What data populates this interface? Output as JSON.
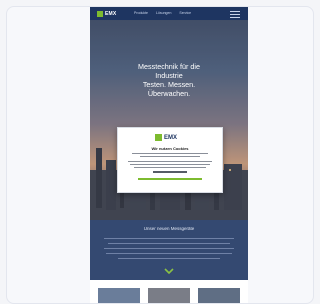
{
  "header": {
    "logo_text": "EMX",
    "nav": [
      "Produkte",
      "Lösungen",
      "Service"
    ]
  },
  "hero": {
    "title": "Messtechnik für die\nIndustrie\nTesten. Messen.\nÜberwachen."
  },
  "modal": {
    "logo_text": "EMX",
    "title": "Wir nutzen Cookies"
  },
  "section": {
    "title": "Unser neuen Messgeräte"
  },
  "colors": {
    "brand_navy": "#1e3561",
    "brand_green": "#7dbb2f"
  },
  "icons": [
    "logo-mark-icon",
    "menu-icon",
    "chevron-down-icon"
  ]
}
